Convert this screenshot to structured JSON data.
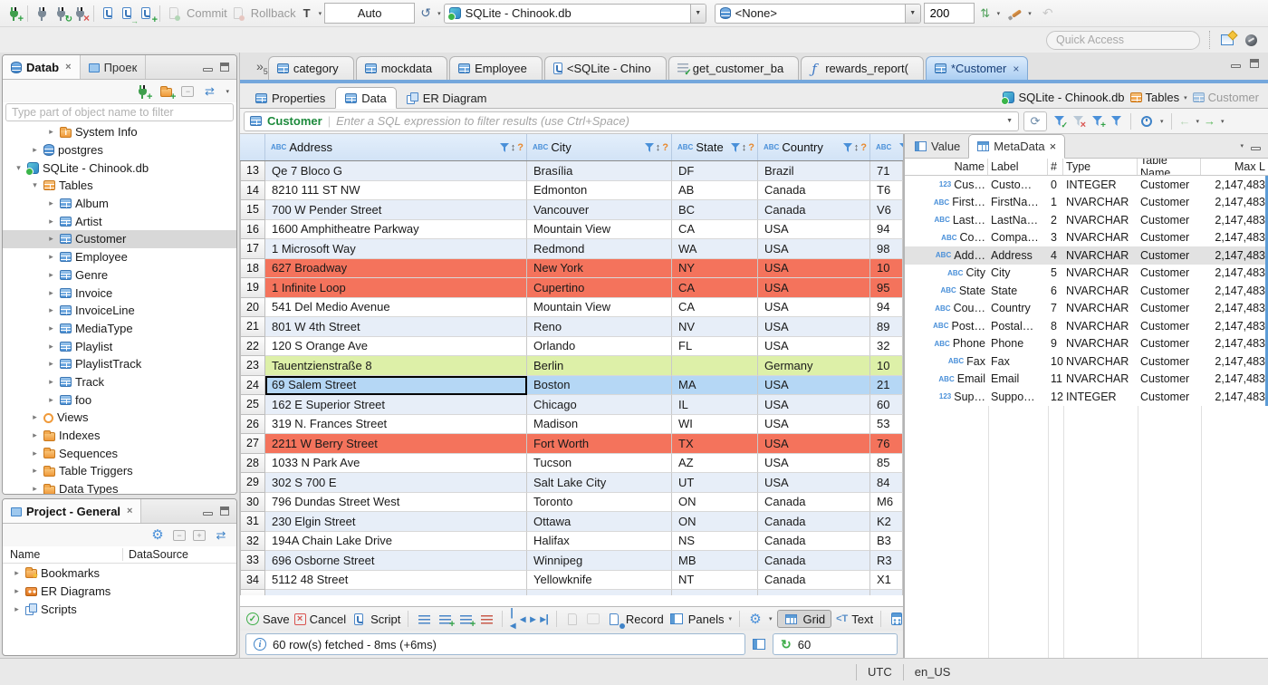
{
  "topbar": {
    "commit_label": "Commit",
    "rollback_label": "Rollback",
    "auto_label": "Auto",
    "connection_combo": "SQLite - Chinook.db",
    "schema_combo": "<None>",
    "fetch_size": "200",
    "quick_access_placeholder": "Quick Access",
    "icons": [
      "new-connection",
      "connect",
      "reconnect",
      "disconnect",
      "new-sql-editor",
      "open-sql-script",
      "new-sql-script",
      "commit",
      "rollback",
      "transaction-mode",
      "connection-history",
      "sync-connection",
      "paint-switch",
      "undo",
      "perspective-db",
      "perspective-dbeaver"
    ]
  },
  "editor_tabs": {
    "overflow_count": "5",
    "tabs": [
      {
        "label": "category",
        "icon": "ic-table",
        "cls": "",
        "close": ""
      },
      {
        "label": "mockdata",
        "icon": "ic-table",
        "cls": "",
        "close": ""
      },
      {
        "label": "Employee",
        "icon": "ic-table",
        "cls": "",
        "close": ""
      },
      {
        "label": "<SQLite - Chino",
        "icon": "ic-sql",
        "cls": "",
        "close": ""
      },
      {
        "label": "get_customer_ba",
        "icon": "ic-scriptcheck",
        "cls": "",
        "close": ""
      },
      {
        "label": "rewards_report(",
        "icon": "ic-fn",
        "cls": "",
        "close": ""
      },
      {
        "label": "*Customer",
        "icon": "ic-table",
        "cls": "active",
        "close": "×"
      }
    ]
  },
  "sidebar": {
    "tab_db": "Datab",
    "tab_db_close": "×",
    "tab_project": "Проек",
    "filter_placeholder": "Type part of object name to filter",
    "tree": [
      {
        "label": "System Info",
        "icon": "ic-sysinfo",
        "arrow": "▸",
        "ind": "i2",
        "cls": ""
      },
      {
        "label": "postgres",
        "icon": "ic-db",
        "arrow": "▸",
        "ind": "i1",
        "cls": ""
      },
      {
        "label": "SQLite - Chinook.db",
        "icon": "ic-sqlite",
        "arrow": "▾",
        "ind": "i0",
        "cls": ""
      },
      {
        "label": "Tables",
        "icon": "ic-tabfolder",
        "arrow": "▾",
        "ind": "i1",
        "cls": ""
      },
      {
        "label": "Album",
        "icon": "ic-table",
        "arrow": "▸",
        "ind": "i2",
        "cls": ""
      },
      {
        "label": "Artist",
        "icon": "ic-table",
        "arrow": "▸",
        "ind": "i2",
        "cls": ""
      },
      {
        "label": "Customer",
        "icon": "ic-table",
        "arrow": "▸",
        "ind": "i2",
        "cls": "selected"
      },
      {
        "label": "Employee",
        "icon": "ic-table",
        "arrow": "▸",
        "ind": "i2",
        "cls": ""
      },
      {
        "label": "Genre",
        "icon": "ic-table",
        "arrow": "▸",
        "ind": "i2",
        "cls": ""
      },
      {
        "label": "Invoice",
        "icon": "ic-table",
        "arrow": "▸",
        "ind": "i2",
        "cls": ""
      },
      {
        "label": "InvoiceLine",
        "icon": "ic-table",
        "arrow": "▸",
        "ind": "i2",
        "cls": ""
      },
      {
        "label": "MediaType",
        "icon": "ic-table",
        "arrow": "▸",
        "ind": "i2",
        "cls": ""
      },
      {
        "label": "Playlist",
        "icon": "ic-table",
        "arrow": "▸",
        "ind": "i2",
        "cls": ""
      },
      {
        "label": "PlaylistTrack",
        "icon": "ic-table",
        "arrow": "▸",
        "ind": "i2",
        "cls": ""
      },
      {
        "label": "Track",
        "icon": "ic-table",
        "arrow": "▸",
        "ind": "i2",
        "cls": ""
      },
      {
        "label": "foo",
        "icon": "ic-table",
        "arrow": "▸",
        "ind": "i2",
        "cls": ""
      },
      {
        "label": "Views",
        "icon": "ic-eye",
        "arrow": "▸",
        "ind": "i1",
        "cls": ""
      },
      {
        "label": "Indexes",
        "icon": "ic-folder",
        "arrow": "▸",
        "ind": "i1",
        "cls": ""
      },
      {
        "label": "Sequences",
        "icon": "ic-folder",
        "arrow": "▸",
        "ind": "i1",
        "cls": ""
      },
      {
        "label": "Table Triggers",
        "icon": "ic-folder",
        "arrow": "▸",
        "ind": "i1",
        "cls": ""
      },
      {
        "label": "Data Types",
        "icon": "ic-folder",
        "arrow": "▸",
        "ind": "i1",
        "cls": ""
      }
    ]
  },
  "project_panel": {
    "title": "Project - General",
    "close": "×",
    "col_name": "Name",
    "col_datasource": "DataSource",
    "items": [
      {
        "label": "Bookmarks",
        "icon": "ic-bookmarks",
        "arrow": "▸"
      },
      {
        "label": "ER Diagrams",
        "icon": "ic-erd",
        "arrow": "▸"
      },
      {
        "label": "Scripts",
        "icon": "ic-scripts",
        "arrow": "▸"
      }
    ]
  },
  "subtabs": {
    "properties": "Properties",
    "data": "Data",
    "er_diagram": "ER Diagram"
  },
  "breadcrumb": {
    "db": "SQLite - Chinook.db",
    "folder": "Tables",
    "table": "Customer"
  },
  "filter_bar": {
    "table": "Customer",
    "placeholder": "Enter a SQL expression to filter results (use Ctrl+Space)"
  },
  "grid": {
    "columns": [
      {
        "badge": "ABC",
        "label": "Address",
        "wcls": "c-addr",
        "icls": ""
      },
      {
        "badge": "ABC",
        "label": "City",
        "wcls": "c-city",
        "icls": ""
      },
      {
        "badge": "ABC",
        "label": "State",
        "wcls": "c-state",
        "icls": ""
      },
      {
        "badge": "ABC",
        "label": "Country",
        "wcls": "c-country",
        "icls": ""
      },
      {
        "badge": "ABC",
        "label": "",
        "wcls": "c-postal",
        "icls": "hide"
      }
    ],
    "rows": [
      {
        "num": "13",
        "address": "Qe 7 Bloco G",
        "city": "Brasília",
        "state": "DF",
        "country": "Brazil",
        "postal": "71",
        "cls": "alt",
        "acls": ""
      },
      {
        "num": "14",
        "address": "8210 111 ST NW",
        "city": "Edmonton",
        "state": "AB",
        "country": "Canada",
        "postal": "T6",
        "cls": "",
        "acls": ""
      },
      {
        "num": "15",
        "address": "700 W Pender Street",
        "city": "Vancouver",
        "state": "BC",
        "country": "Canada",
        "postal": "V6",
        "cls": "alt",
        "acls": ""
      },
      {
        "num": "16",
        "address": "1600 Amphitheatre Parkway",
        "city": "Mountain View",
        "state": "CA",
        "country": "USA",
        "postal": "94",
        "cls": "",
        "acls": ""
      },
      {
        "num": "17",
        "address": "1 Microsoft Way",
        "city": "Redmond",
        "state": "WA",
        "country": "USA",
        "postal": "98",
        "cls": "alt",
        "acls": ""
      },
      {
        "num": "18",
        "address": "627 Broadway",
        "city": "New York",
        "state": "NY",
        "country": "USA",
        "postal": "10",
        "cls": "hl-red",
        "acls": ""
      },
      {
        "num": "19",
        "address": "1 Infinite Loop",
        "city": "Cupertino",
        "state": "CA",
        "country": "USA",
        "postal": "95",
        "cls": "hl-red",
        "acls": ""
      },
      {
        "num": "20",
        "address": "541 Del Medio Avenue",
        "city": "Mountain View",
        "state": "CA",
        "country": "USA",
        "postal": "94",
        "cls": "",
        "acls": ""
      },
      {
        "num": "21",
        "address": "801 W 4th Street",
        "city": "Reno",
        "state": "NV",
        "country": "USA",
        "postal": "89",
        "cls": "alt",
        "acls": ""
      },
      {
        "num": "22",
        "address": "120 S Orange Ave",
        "city": "Orlando",
        "state": "FL",
        "country": "USA",
        "postal": "32",
        "cls": "",
        "acls": ""
      },
      {
        "num": "23",
        "address": "Tauentzienstraße 8",
        "city": "Berlin",
        "state": "",
        "country": "Germany",
        "postal": "10",
        "cls": "hl-green",
        "acls": ""
      },
      {
        "num": "24",
        "address": "69 Salem Street",
        "city": "Boston",
        "state": "MA",
        "country": "USA",
        "postal": "21",
        "cls": "sel",
        "acls": "focus"
      },
      {
        "num": "25",
        "address": "162 E Superior Street",
        "city": "Chicago",
        "state": "IL",
        "country": "USA",
        "postal": "60",
        "cls": "alt",
        "acls": ""
      },
      {
        "num": "26",
        "address": "319 N. Frances Street",
        "city": "Madison",
        "state": "WI",
        "country": "USA",
        "postal": "53",
        "cls": "",
        "acls": ""
      },
      {
        "num": "27",
        "address": "2211 W Berry Street",
        "city": "Fort Worth",
        "state": "TX",
        "country": "USA",
        "postal": "76",
        "cls": "hl-red",
        "acls": ""
      },
      {
        "num": "28",
        "address": "1033 N Park Ave",
        "city": "Tucson",
        "state": "AZ",
        "country": "USA",
        "postal": "85",
        "cls": "",
        "acls": ""
      },
      {
        "num": "29",
        "address": "302 S 700 E",
        "city": "Salt Lake City",
        "state": "UT",
        "country": "USA",
        "postal": "84",
        "cls": "alt",
        "acls": ""
      },
      {
        "num": "30",
        "address": "796 Dundas Street West",
        "city": "Toronto",
        "state": "ON",
        "country": "Canada",
        "postal": "M6",
        "cls": "",
        "acls": ""
      },
      {
        "num": "31",
        "address": "230 Elgin Street",
        "city": "Ottawa",
        "state": "ON",
        "country": "Canada",
        "postal": "K2",
        "cls": "alt",
        "acls": ""
      },
      {
        "num": "32",
        "address": "194A Chain Lake Drive",
        "city": "Halifax",
        "state": "NS",
        "country": "Canada",
        "postal": "B3",
        "cls": "",
        "acls": ""
      },
      {
        "num": "33",
        "address": "696 Osborne Street",
        "city": "Winnipeg",
        "state": "MB",
        "country": "Canada",
        "postal": "R3",
        "cls": "alt",
        "acls": ""
      },
      {
        "num": "34",
        "address": "5112 48 Street",
        "city": "Yellowknife",
        "state": "NT",
        "country": "Canada",
        "postal": "X1",
        "cls": "",
        "acls": ""
      }
    ]
  },
  "metadata": {
    "tab_value": "Value",
    "tab_metadata": "MetaData",
    "tab_metadata_close": "×",
    "columns": {
      "name": "Name",
      "label": "Label",
      "idx": "#",
      "type": "Type",
      "table": "Table Name",
      "max": "Max L"
    },
    "rows": [
      {
        "badge": "123",
        "name": "Cus…",
        "label": "Custo…",
        "idx": "0",
        "type": "INTEGER",
        "table": "Customer",
        "max": "2,147,483",
        "cls": ""
      },
      {
        "badge": "ABC",
        "name": "First…",
        "label": "FirstNa…",
        "idx": "1",
        "type": "NVARCHAR",
        "table": "Customer",
        "max": "2,147,483",
        "cls": ""
      },
      {
        "badge": "ABC",
        "name": "Last…",
        "label": "LastNa…",
        "idx": "2",
        "type": "NVARCHAR",
        "table": "Customer",
        "max": "2,147,483",
        "cls": ""
      },
      {
        "badge": "ABC",
        "name": "Co…",
        "label": "Compa…",
        "idx": "3",
        "type": "NVARCHAR",
        "table": "Customer",
        "max": "2,147,483",
        "cls": ""
      },
      {
        "badge": "ABC",
        "name": "Add…",
        "label": "Address",
        "idx": "4",
        "type": "NVARCHAR",
        "table": "Customer",
        "max": "2,147,483",
        "cls": "sel"
      },
      {
        "badge": "ABC",
        "name": "City",
        "label": "City",
        "idx": "5",
        "type": "NVARCHAR",
        "table": "Customer",
        "max": "2,147,483",
        "cls": ""
      },
      {
        "badge": "ABC",
        "name": "State",
        "label": "State",
        "idx": "6",
        "type": "NVARCHAR",
        "table": "Customer",
        "max": "2,147,483",
        "cls": ""
      },
      {
        "badge": "ABC",
        "name": "Cou…",
        "label": "Country",
        "idx": "7",
        "type": "NVARCHAR",
        "table": "Customer",
        "max": "2,147,483",
        "cls": ""
      },
      {
        "badge": "ABC",
        "name": "Post…",
        "label": "Postal…",
        "idx": "8",
        "type": "NVARCHAR",
        "table": "Customer",
        "max": "2,147,483",
        "cls": ""
      },
      {
        "badge": "ABC",
        "name": "Phone",
        "label": "Phone",
        "idx": "9",
        "type": "NVARCHAR",
        "table": "Customer",
        "max": "2,147,483",
        "cls": ""
      },
      {
        "badge": "ABC",
        "name": "Fax",
        "label": "Fax",
        "idx": "10",
        "type": "NVARCHAR",
        "table": "Customer",
        "max": "2,147,483",
        "cls": ""
      },
      {
        "badge": "ABC",
        "name": "Email",
        "label": "Email",
        "idx": "11",
        "type": "NVARCHAR",
        "table": "Customer",
        "max": "2,147,483",
        "cls": ""
      },
      {
        "badge": "123",
        "name": "Sup…",
        "label": "Suppo…",
        "idx": "12",
        "type": "INTEGER",
        "table": "Customer",
        "max": "2,147,483",
        "cls": ""
      }
    ]
  },
  "bottom_toolbar": {
    "save": "Save",
    "cancel": "Cancel",
    "script": "Script",
    "record": "Record",
    "panels": "Panels",
    "grid": "Grid",
    "text": "Text",
    "icons": [
      "apply-row-changes",
      "add-row",
      "duplicate-row",
      "delete-row",
      "first-page",
      "previous-page",
      "next-page",
      "last-page",
      "fetch-next-page",
      "fetch-all",
      "gear-menu",
      "calculator-panel"
    ]
  },
  "status": {
    "message": "60 row(s) fetched - 8ms (+6ms)",
    "refresh_count": "60",
    "timezone": "UTC",
    "locale": "en_US"
  }
}
